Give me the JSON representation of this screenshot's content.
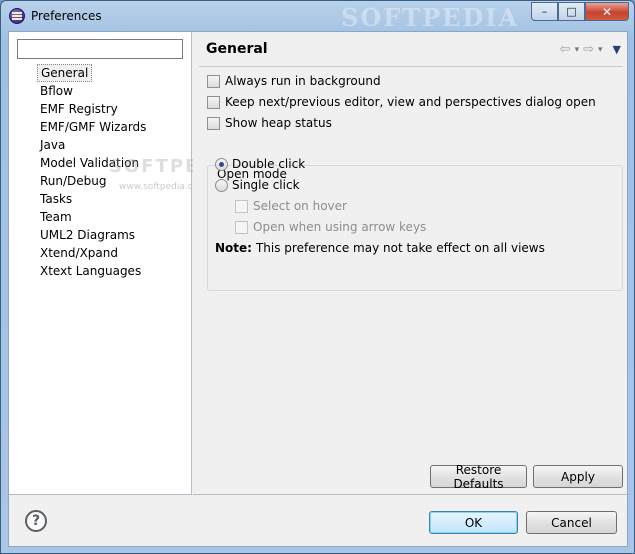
{
  "window": {
    "title": "Preferences",
    "watermark": "SOFTPEDIA",
    "controls": {
      "minimize": "–",
      "maximize": "□",
      "close": "✕"
    }
  },
  "sidebar": {
    "filter_value": "",
    "watermark": "SOFTPEDIA",
    "watermark_url": "www.softpedia.com",
    "items": [
      {
        "label": "General",
        "selected": true
      },
      {
        "label": "Bflow"
      },
      {
        "label": "EMF Registry"
      },
      {
        "label": "EMF/GMF Wizards"
      },
      {
        "label": "Java"
      },
      {
        "label": "Model Validation"
      },
      {
        "label": "Run/Debug"
      },
      {
        "label": "Tasks"
      },
      {
        "label": "Team"
      },
      {
        "label": "UML2 Diagrams"
      },
      {
        "label": "Xtend/Xpand"
      },
      {
        "label": "Xtext Languages"
      }
    ]
  },
  "page": {
    "title": "General",
    "nav": {
      "back": "⇦",
      "forward": "⇨",
      "dropdown": "▾",
      "menu": "▼"
    },
    "options": {
      "always_run_bg": {
        "label": "Always run in background",
        "checked": false
      },
      "keep_next_prev": {
        "label": "Keep next/previous editor, view and perspectives dialog open",
        "checked": false
      },
      "show_heap": {
        "label": "Show heap status",
        "checked": false
      }
    },
    "open_mode": {
      "label": "Open mode",
      "double_click": "Double click",
      "single_click": "Single click",
      "select_on_hover": "Select on hover",
      "open_arrow_keys": "Open when using arrow keys",
      "selected": "double_click"
    },
    "note": {
      "prefix": "Note:",
      "text": "This preference may not take effect on all views"
    },
    "restore_defaults": "Restore Defaults",
    "apply": "Apply"
  },
  "footer": {
    "help": "?",
    "ok": "OK",
    "cancel": "Cancel"
  }
}
